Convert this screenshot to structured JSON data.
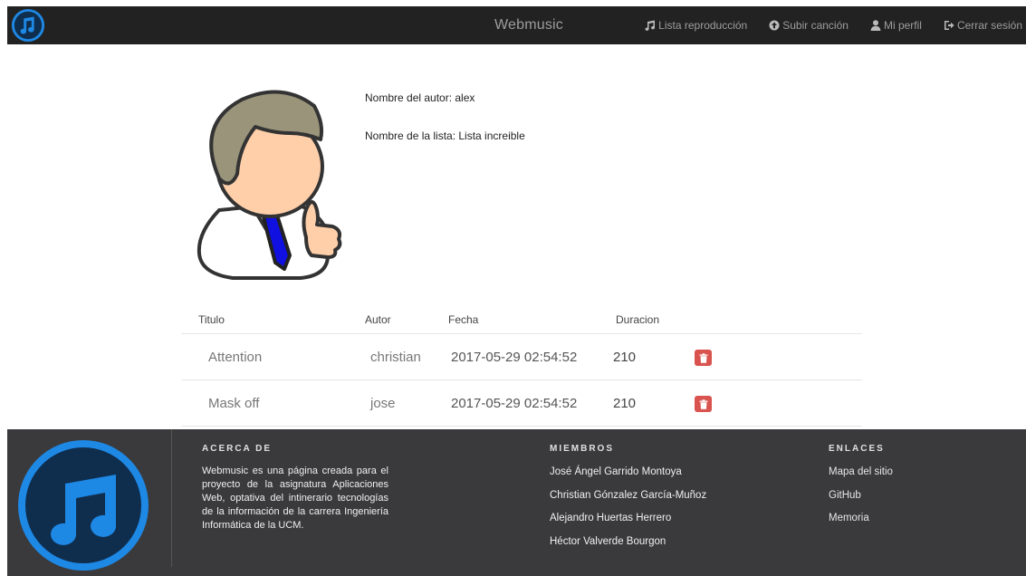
{
  "navbar": {
    "brand": "Webmusic",
    "links": [
      {
        "label": "Lista reproducción",
        "icon": "music-note-icon"
      },
      {
        "label": "Subir canción",
        "icon": "upload-circle-icon"
      },
      {
        "label": "Mi perfil",
        "icon": "user-icon"
      },
      {
        "label": "Cerrar sesión",
        "icon": "logout-icon"
      }
    ],
    "logo_icon": "music-note-circle-icon"
  },
  "profile": {
    "author_line": "Nombre del autor: alex",
    "list_line": "Nombre de la lista: Lista increible",
    "avatar_icon": "businessman-thumbs-up-avatar"
  },
  "table": {
    "headers": {
      "title": "Titulo",
      "author": "Autor",
      "date": "Fecha",
      "duration": "Duracion"
    },
    "rows": [
      {
        "title": "Attention",
        "author": "christian",
        "date": "2017-05-29 02:54:52",
        "duration": "210",
        "action_icon": "trash-icon"
      },
      {
        "title": "Mask off",
        "author": "jose",
        "date": "2017-05-29 02:54:52",
        "duration": "210",
        "action_icon": "trash-icon"
      }
    ]
  },
  "footer": {
    "about": {
      "heading": "ACERCA DE",
      "text": "Webmusic es una página creada para el proyecto de la asignatura Aplicaciones Web, optativa del intinerario tecnologías de la información de la carrera Ingeniería Informática de la UCM."
    },
    "members": {
      "heading": "MIEMBROS",
      "items": [
        "José Ángel Garrido Montoya",
        "Christian Gónzalez García-Muñoz",
        "Alejandro Huertas Herrero",
        "Héctor Valverde Bourgon"
      ]
    },
    "links": {
      "heading": "ENLACES",
      "items": [
        "Mapa del sitio",
        "GitHub",
        "Memoria"
      ]
    }
  },
  "colors": {
    "navbar_bg": "#222222",
    "brand_blue": "#1e88e5",
    "footer_bg": "#3a3a3d",
    "delete_red": "#d9534f"
  }
}
